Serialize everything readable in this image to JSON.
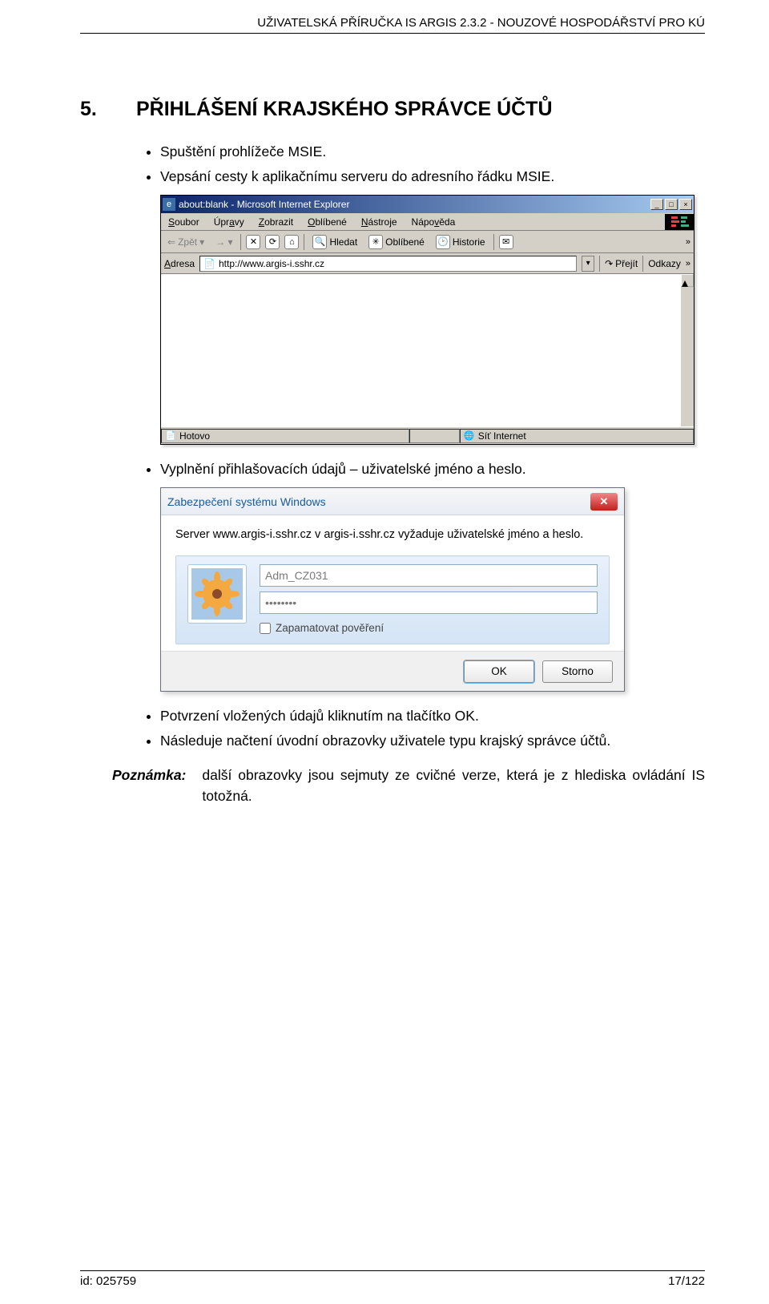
{
  "header": {
    "text": "UŽIVATELSKÁ PŘÍRUČKA IS ARGIS 2.3.2 - NOUZOVÉ HOSPODÁŘSTVÍ PRO KÚ"
  },
  "section": {
    "number": "5.",
    "title": "PŘIHLÁŠENÍ KRAJSKÉHO SPRÁVCE ÚČTŮ"
  },
  "bullets": {
    "b1": "Spuštění prohlížeče MSIE.",
    "b2": "Vepsání cesty k aplikačnímu serveru do adresního řádku MSIE.",
    "b3": "Vyplnění přihlašovacích údajů – uživatelské jméno a heslo.",
    "b4": "Potvrzení vložených údajů kliknutím na tlačítko OK.",
    "b5": "Následuje načtení úvodní obrazovky uživatele typu krajský správce účtů."
  },
  "ie": {
    "title": "about:blank - Microsoft Internet Explorer",
    "menu": {
      "soubor": "Soubor",
      "upravy": "Úpravy",
      "zobrazit": "Zobrazit",
      "oblibene": "Oblíbené",
      "nastroje": "Nástroje",
      "napoveda": "Nápověda"
    },
    "toolbar": {
      "zpet": "Zpět",
      "hledat": "Hledat",
      "oblibene": "Oblíbené",
      "historie": "Historie"
    },
    "addressbar": {
      "label": "Adresa",
      "url": "http://www.argis-i.sshr.cz",
      "go": "Přejít",
      "links": "Odkazy"
    },
    "status": {
      "left": "Hotovo",
      "right": "Síť Internet"
    }
  },
  "cred": {
    "title": "Zabezpečení systému Windows",
    "message": "Server www.argis-i.sshr.cz v argis-i.sshr.cz vyžaduje uživatelské jméno a heslo.",
    "username": "Adm_CZ031",
    "password": "••••••••",
    "remember": "Zapamatovat pověření",
    "ok": "OK",
    "cancel": "Storno"
  },
  "note": {
    "label": "Poznámka:",
    "text": "další obrazovky jsou sejmuty ze cvičné verze, která je z hlediska ovládání IS totožná."
  },
  "footer": {
    "left": "id: 025759",
    "right": "17/122"
  }
}
